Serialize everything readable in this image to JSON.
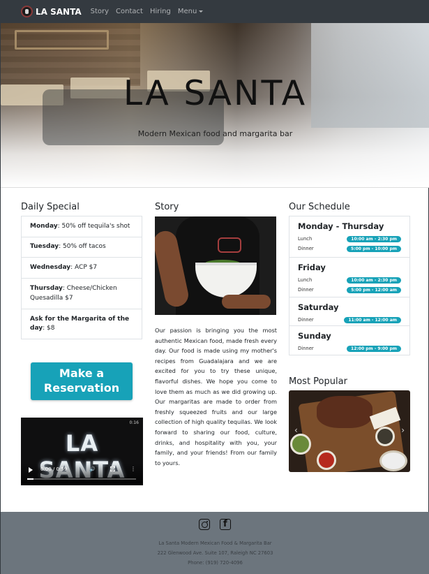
{
  "nav": {
    "brand": "LA SANTA",
    "links": [
      "Story",
      "Contact",
      "Hiring",
      "Menu"
    ]
  },
  "hero": {
    "title": "LA SANTA",
    "subtitle": "Modern Mexican food and margarita bar"
  },
  "specials": {
    "heading": "Daily Special",
    "items": [
      {
        "day": "Monday",
        "text": ": 50% off tequila's shot"
      },
      {
        "day": "Tuesday",
        "text": ": 50% off tacos"
      },
      {
        "day": "Wednesday",
        "text": ": ACP $7"
      },
      {
        "day": "Thursday",
        "text": ": Cheese/Chicken Quesadilla $7"
      },
      {
        "day": "Ask for the Margarita of the day",
        "text": ": $8"
      }
    ]
  },
  "reservation": {
    "line1": "Make a",
    "line2": "Reservation"
  },
  "video": {
    "logo": "LA SANTA",
    "time_display": "0:00 / 0:59",
    "duration_badge": "0:16",
    "progress_fraction": 0.06
  },
  "story": {
    "heading": "Story",
    "text": "Our passion is bringing you the most authentic Mexican food, made fresh every day. Our food is made using my mother's recipes from Guadalajara and we are excited for you to try these unique, flavorful dishes. We hope you come to love them as much as we did growing up. Our margaritas are made to order from freshly squeezed fruits and our large collection of high quality tequilas. We look forward to sharing our food, culture, drinks, and hospitality with you, your family, and your friends! From our family to yours."
  },
  "schedule": {
    "heading": "Our Schedule",
    "blocks": [
      {
        "day": "Monday - Thursday",
        "rows": [
          {
            "label": "Lunch",
            "hours": "10:00 am - 2:30 pm"
          },
          {
            "label": "Dinner",
            "hours": "5:00 pm - 10:00 pm"
          }
        ]
      },
      {
        "day": "Friday",
        "rows": [
          {
            "label": "Lunch",
            "hours": "10:00 am - 2:30 pm"
          },
          {
            "label": "Dinner",
            "hours": "5:00 pm - 12:00 am"
          }
        ]
      },
      {
        "day": "Saturday",
        "rows": [
          {
            "label": "Dinner",
            "hours": "11:00 am - 12:00 am"
          }
        ]
      },
      {
        "day": "Sunday",
        "rows": [
          {
            "label": "Dinner",
            "hours": "12:00 pm - 9:00 pm"
          }
        ]
      }
    ]
  },
  "popular": {
    "heading": "Most Popular"
  },
  "footer": {
    "name": "La Santa Modern Mexican Food & Margarita Bar",
    "address": "222 Glenwood Ave. Suite 107, Raleigh NC 27603",
    "phone": "Phone: (919) 720-4096"
  },
  "colors": {
    "navbar": "#343a40",
    "accent": "#17a2b8",
    "footer": "#6c757d"
  }
}
